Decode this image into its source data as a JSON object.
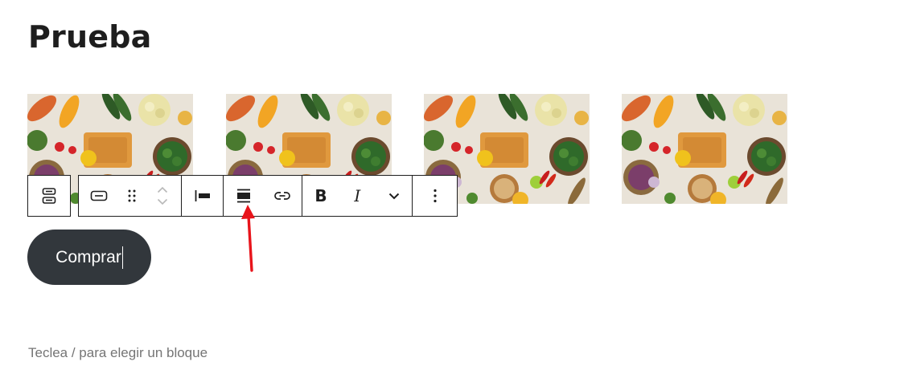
{
  "post": {
    "title": "Prueba"
  },
  "gallery": {
    "images": [
      {
        "alt": "vegetables-photo"
      },
      {
        "alt": "vegetables-photo"
      },
      {
        "alt": "vegetables-photo"
      },
      {
        "alt": "vegetables-photo"
      }
    ]
  },
  "toolbar": {
    "parent_icon": "buttons-block-icon",
    "block_type_icon": "button-block-icon",
    "drag_icon": "drag-handle-icon",
    "move_up_icon": "chevron-up-icon",
    "move_down_icon": "chevron-down-icon",
    "justify_icon": "justify-left-icon",
    "align_icon": "align-wide-icon",
    "link_icon": "link-icon",
    "bold_label": "B",
    "italic_label": "I",
    "more_formats_icon": "chevron-down-icon",
    "options_icon": "more-vertical-icon"
  },
  "button_block": {
    "text": "Comprar"
  },
  "editor": {
    "placeholder": "Teclea / para elegir un bloque"
  },
  "colors": {
    "button_bg": "#32373c",
    "annotation_arrow": "#e8141b"
  }
}
